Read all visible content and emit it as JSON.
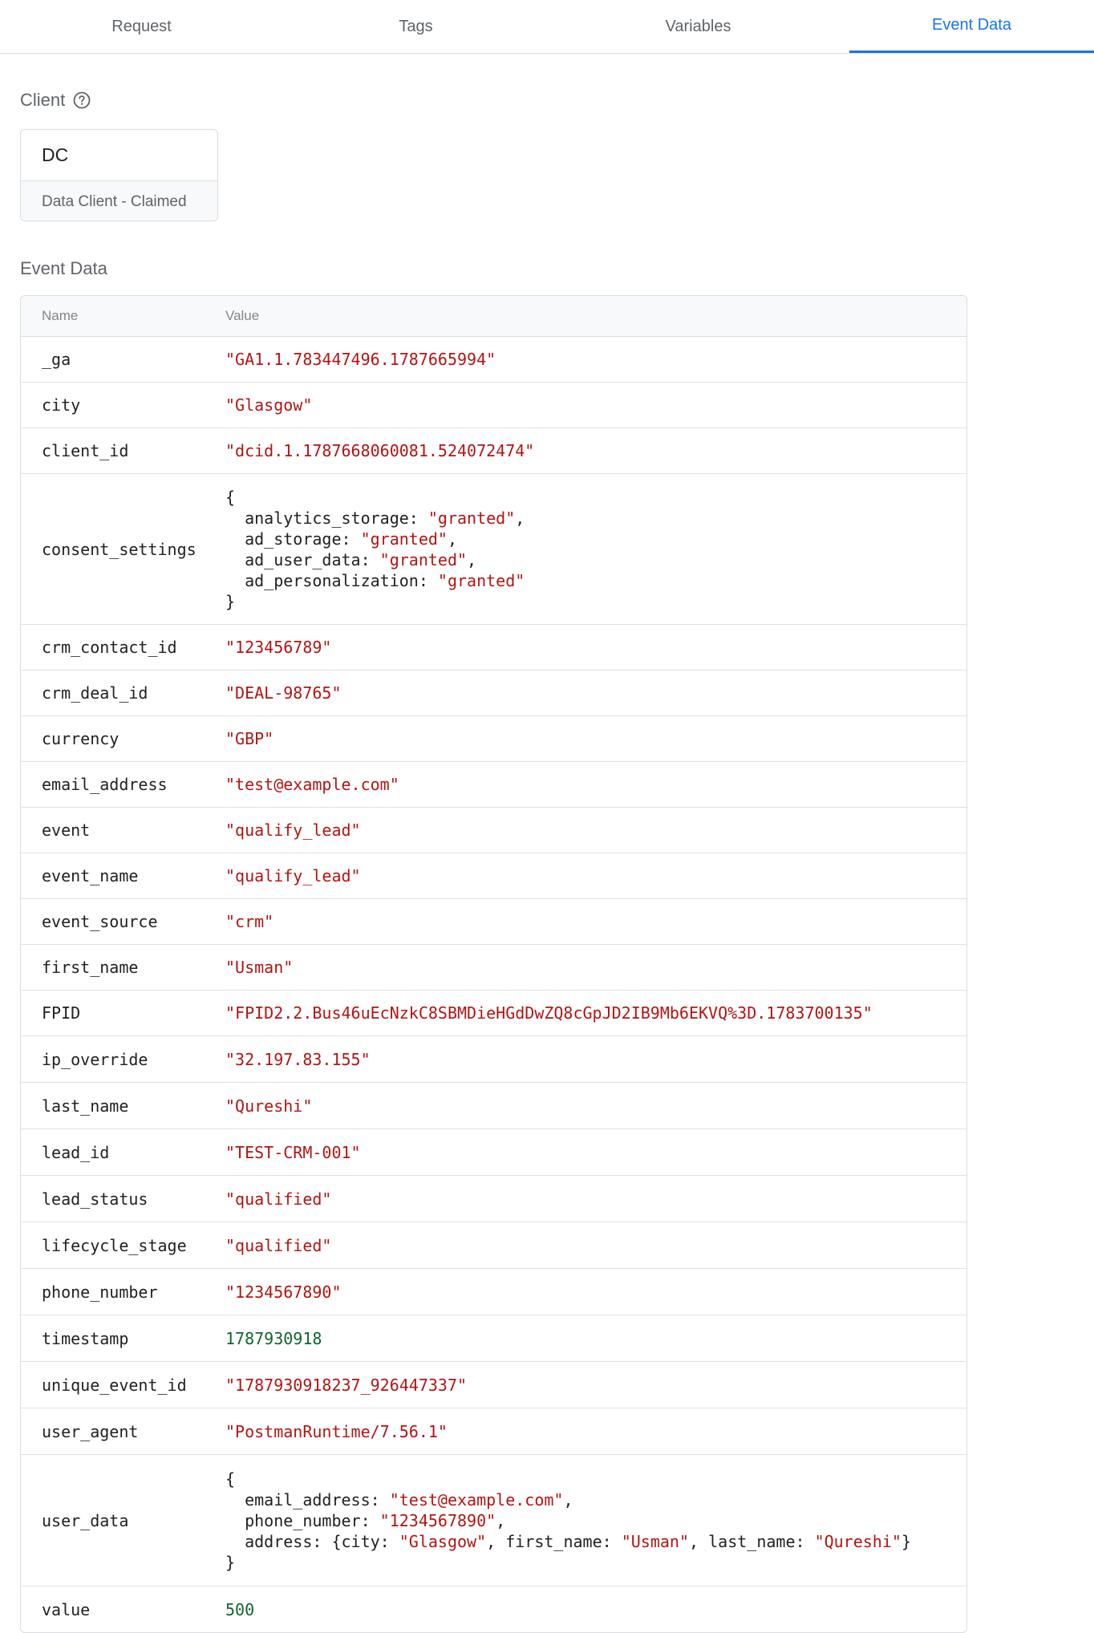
{
  "tabs": [
    {
      "label": "Request",
      "active": false
    },
    {
      "label": "Tags",
      "active": false
    },
    {
      "label": "Variables",
      "active": false
    },
    {
      "label": "Event Data",
      "active": true
    }
  ],
  "client_section": {
    "title": "Client",
    "help_icon": "help-circle-icon"
  },
  "client": {
    "name": "DC",
    "status": "Data Client - Claimed"
  },
  "event_section": {
    "title": "Event Data"
  },
  "table": {
    "headers": {
      "name": "Name",
      "value": "Value"
    },
    "rows": [
      {
        "name": "_ga",
        "type": "string",
        "value": "\"GA1.1.783447496.1787665994\""
      },
      {
        "name": "city",
        "type": "string",
        "value": "\"Glasgow\""
      },
      {
        "name": "client_id",
        "type": "string",
        "value": "\"dcid.1.1787668060081.524072474\""
      },
      {
        "name": "consent_settings",
        "type": "object",
        "entries": [
          {
            "key": "analytics_storage: ",
            "value": "\"granted\"",
            "sep": ","
          },
          {
            "key": "ad_storage: ",
            "value": "\"granted\"",
            "sep": ","
          },
          {
            "key": "ad_user_data: ",
            "value": "\"granted\"",
            "sep": ","
          },
          {
            "key": "ad_personalization: ",
            "value": "\"granted\"",
            "sep": ""
          }
        ]
      },
      {
        "name": "crm_contact_id",
        "type": "string",
        "value": "\"123456789\""
      },
      {
        "name": "crm_deal_id",
        "type": "string",
        "value": "\"DEAL-98765\""
      },
      {
        "name": "currency",
        "type": "string",
        "value": "\"GBP\""
      },
      {
        "name": "email_address",
        "type": "string",
        "value": "\"test@example.com\""
      },
      {
        "name": "event",
        "type": "string",
        "value": "\"qualify_lead\""
      },
      {
        "name": "event_name",
        "type": "string",
        "value": "\"qualify_lead\""
      },
      {
        "name": "event_source",
        "type": "string",
        "value": "\"crm\""
      },
      {
        "name": "first_name",
        "type": "string",
        "value": "\"Usman\""
      },
      {
        "name": "FPID",
        "type": "string",
        "value": "\"FPID2.2.Bus46uEcNzkC8SBMDieHGdDwZQ8cGpJD2IB9Mb6EKVQ%3D.1783700135\""
      },
      {
        "name": "ip_override",
        "type": "string",
        "value": "\"32.197.83.155\""
      },
      {
        "name": "last_name",
        "type": "string",
        "value": "\"Qureshi\""
      },
      {
        "name": "lead_id",
        "type": "string",
        "value": "\"TEST-CRM-001\""
      },
      {
        "name": "lead_status",
        "type": "string",
        "value": "\"qualified\""
      },
      {
        "name": "lifecycle_stage",
        "type": "string",
        "value": "\"qualified\""
      },
      {
        "name": "phone_number",
        "type": "string",
        "value": "\"1234567890\""
      },
      {
        "name": "timestamp",
        "type": "number",
        "value": "1787930918"
      },
      {
        "name": "unique_event_id",
        "type": "string",
        "value": "\"1787930918237_926447337\""
      },
      {
        "name": "user_agent",
        "type": "string",
        "value": "\"PostmanRuntime/7.56.1\""
      },
      {
        "name": "user_data",
        "type": "object",
        "entries": [
          {
            "key": "email_address: ",
            "value": "\"test@example.com\"",
            "sep": ","
          },
          {
            "key": "phone_number: ",
            "value": "\"1234567890\"",
            "sep": ","
          },
          {
            "key": "address: {city: ",
            "value": "\"Glasgow\"",
            "sep": ", ",
            "parts": [
              {
                "key": "first_name: ",
                "value": "\"Usman\"",
                "sep": ", "
              },
              {
                "key": "last_name: ",
                "value": "\"Qureshi\"",
                "sep": "}"
              }
            ]
          }
        ]
      },
      {
        "name": "value",
        "type": "number",
        "value": "500"
      }
    ]
  },
  "colors": {
    "accent": "#1a73e8",
    "string": "#b31412",
    "number": "#0d652d"
  }
}
